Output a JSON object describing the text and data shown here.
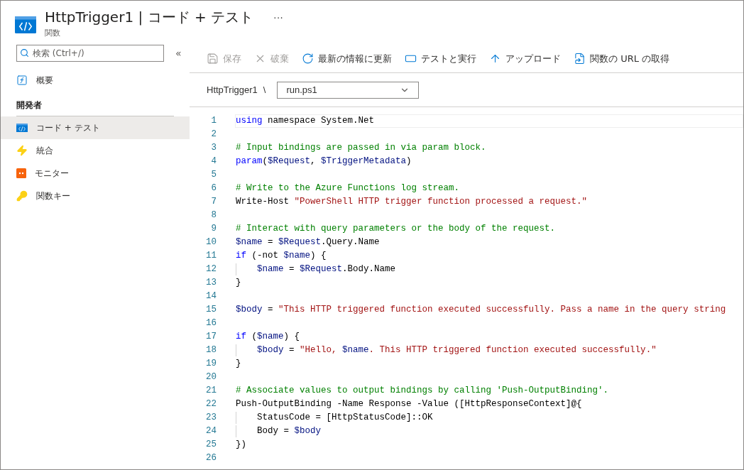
{
  "header": {
    "title": "HttpTrigger1 | コード + テスト",
    "subtitle": "関数",
    "more": "···"
  },
  "sidebar": {
    "search": {
      "placeholder": "検索 (Ctrl+/)"
    },
    "collapse": "«",
    "items": [
      {
        "kind": "function",
        "label": "概要",
        "selected": false
      },
      {
        "kind": "heading",
        "label": "開発者"
      },
      {
        "kind": "code",
        "label": "コード + テスト",
        "selected": true
      },
      {
        "kind": "bolt",
        "label": "統合",
        "selected": false
      },
      {
        "kind": "monitor",
        "label": "モニター",
        "selected": false
      },
      {
        "kind": "key",
        "label": "関数キー",
        "selected": false
      }
    ]
  },
  "toolbar": [
    {
      "kind": "save",
      "label": "保存",
      "disabled": true
    },
    {
      "kind": "discard",
      "label": "破棄",
      "disabled": true
    },
    {
      "kind": "refresh",
      "label": "最新の情報に更新",
      "disabled": false
    },
    {
      "kind": "test",
      "label": "テストと実行",
      "disabled": false
    },
    {
      "kind": "upload",
      "label": "アップロード",
      "disabled": false
    },
    {
      "kind": "url",
      "label": "関数の URL の取得",
      "disabled": false
    }
  ],
  "breadcrumb": {
    "path": "HttpTrigger1",
    "separator": "\\",
    "file": "run.ps1"
  },
  "editor": {
    "lines": [
      {
        "number": "1",
        "current": true,
        "tokens": [
          {
            "kind": "keyword",
            "text": "using"
          },
          {
            "kind": "plain",
            "text": " namespace System.Net"
          }
        ]
      },
      {
        "number": "2",
        "current": false
      },
      {
        "number": "3",
        "current": false,
        "tokens": [
          {
            "kind": "comment",
            "text": "# Input bindings are passed in via param block."
          }
        ]
      },
      {
        "number": "4",
        "current": false,
        "tokens": [
          {
            "kind": "keyword",
            "text": "param"
          },
          {
            "kind": "plain",
            "text": "("
          },
          {
            "kind": "variable",
            "text": "$Request"
          },
          {
            "kind": "plain",
            "text": ", "
          },
          {
            "kind": "variable",
            "text": "$TriggerMetadata"
          },
          {
            "kind": "plain",
            "text": ")"
          }
        ]
      },
      {
        "number": "5",
        "current": false
      },
      {
        "number": "6",
        "current": false,
        "tokens": [
          {
            "kind": "comment",
            "text": "# Write to the Azure Functions log stream."
          }
        ]
      },
      {
        "number": "7",
        "current": false,
        "tokens": [
          {
            "kind": "plain",
            "text": "Write-Host "
          },
          {
            "kind": "string",
            "text": "\"PowerShell HTTP trigger function processed a request.\""
          }
        ]
      },
      {
        "number": "8",
        "current": false
      },
      {
        "number": "9",
        "current": false,
        "tokens": [
          {
            "kind": "comment",
            "text": "# Interact with query parameters or the body of the request."
          }
        ]
      },
      {
        "number": "10",
        "current": false,
        "tokens": [
          {
            "kind": "variable",
            "text": "$name"
          },
          {
            "kind": "plain",
            "text": " = "
          },
          {
            "kind": "variable",
            "text": "$Request"
          },
          {
            "kind": "plain",
            "text": ".Query.Name"
          }
        ]
      },
      {
        "number": "11",
        "current": false,
        "tokens": [
          {
            "kind": "keyword",
            "text": "if"
          },
          {
            "kind": "plain",
            "text": " (-not "
          },
          {
            "kind": "variable",
            "text": "$name"
          },
          {
            "kind": "plain",
            "text": ") {"
          }
        ]
      },
      {
        "number": "12",
        "current": false,
        "tokens": [
          {
            "kind": "indent"
          },
          {
            "kind": "variable",
            "text": "$name"
          },
          {
            "kind": "plain",
            "text": " = "
          },
          {
            "kind": "variable",
            "text": "$Request"
          },
          {
            "kind": "plain",
            "text": ".Body.Name"
          }
        ]
      },
      {
        "number": "13",
        "current": false,
        "tokens": [
          {
            "kind": "plain",
            "text": "}"
          }
        ]
      },
      {
        "number": "14",
        "current": false
      },
      {
        "number": "15",
        "current": false,
        "tokens": [
          {
            "kind": "variable",
            "text": "$body"
          },
          {
            "kind": "plain",
            "text": " = "
          },
          {
            "kind": "string",
            "text": "\"This HTTP triggered function executed successfully. Pass a name in the query string"
          }
        ]
      },
      {
        "number": "16",
        "current": false
      },
      {
        "number": "17",
        "current": false,
        "tokens": [
          {
            "kind": "keyword",
            "text": "if"
          },
          {
            "kind": "plain",
            "text": " ("
          },
          {
            "kind": "variable",
            "text": "$name"
          },
          {
            "kind": "plain",
            "text": ") {"
          }
        ]
      },
      {
        "number": "18",
        "current": false,
        "tokens": [
          {
            "kind": "indent"
          },
          {
            "kind": "variable",
            "text": "$body"
          },
          {
            "kind": "plain",
            "text": " = "
          },
          {
            "kind": "string",
            "text": "\"Hello, "
          },
          {
            "kind": "variable",
            "text": "$name"
          },
          {
            "kind": "string",
            "text": ". This HTTP triggered function executed successfully.\""
          }
        ]
      },
      {
        "number": "19",
        "current": false,
        "tokens": [
          {
            "kind": "plain",
            "text": "}"
          }
        ]
      },
      {
        "number": "20",
        "current": false
      },
      {
        "number": "21",
        "current": false,
        "tokens": [
          {
            "kind": "comment",
            "text": "# Associate values to output bindings by calling 'Push-OutputBinding'."
          }
        ]
      },
      {
        "number": "22",
        "current": false,
        "tokens": [
          {
            "kind": "plain",
            "text": "Push-OutputBinding -Name Response -Value ([HttpResponseContext]@{"
          }
        ]
      },
      {
        "number": "23",
        "current": false,
        "tokens": [
          {
            "kind": "indent"
          },
          {
            "kind": "plain",
            "text": "StatusCode = [HttpStatusCode]::OK"
          }
        ]
      },
      {
        "number": "24",
        "current": false,
        "tokens": [
          {
            "kind": "indent"
          },
          {
            "kind": "plain",
            "text": "Body = "
          },
          {
            "kind": "variable",
            "text": "$body"
          }
        ]
      },
      {
        "number": "25",
        "current": false,
        "tokens": [
          {
            "kind": "plain",
            "text": "})"
          }
        ]
      },
      {
        "number": "26",
        "current": false
      }
    ]
  }
}
